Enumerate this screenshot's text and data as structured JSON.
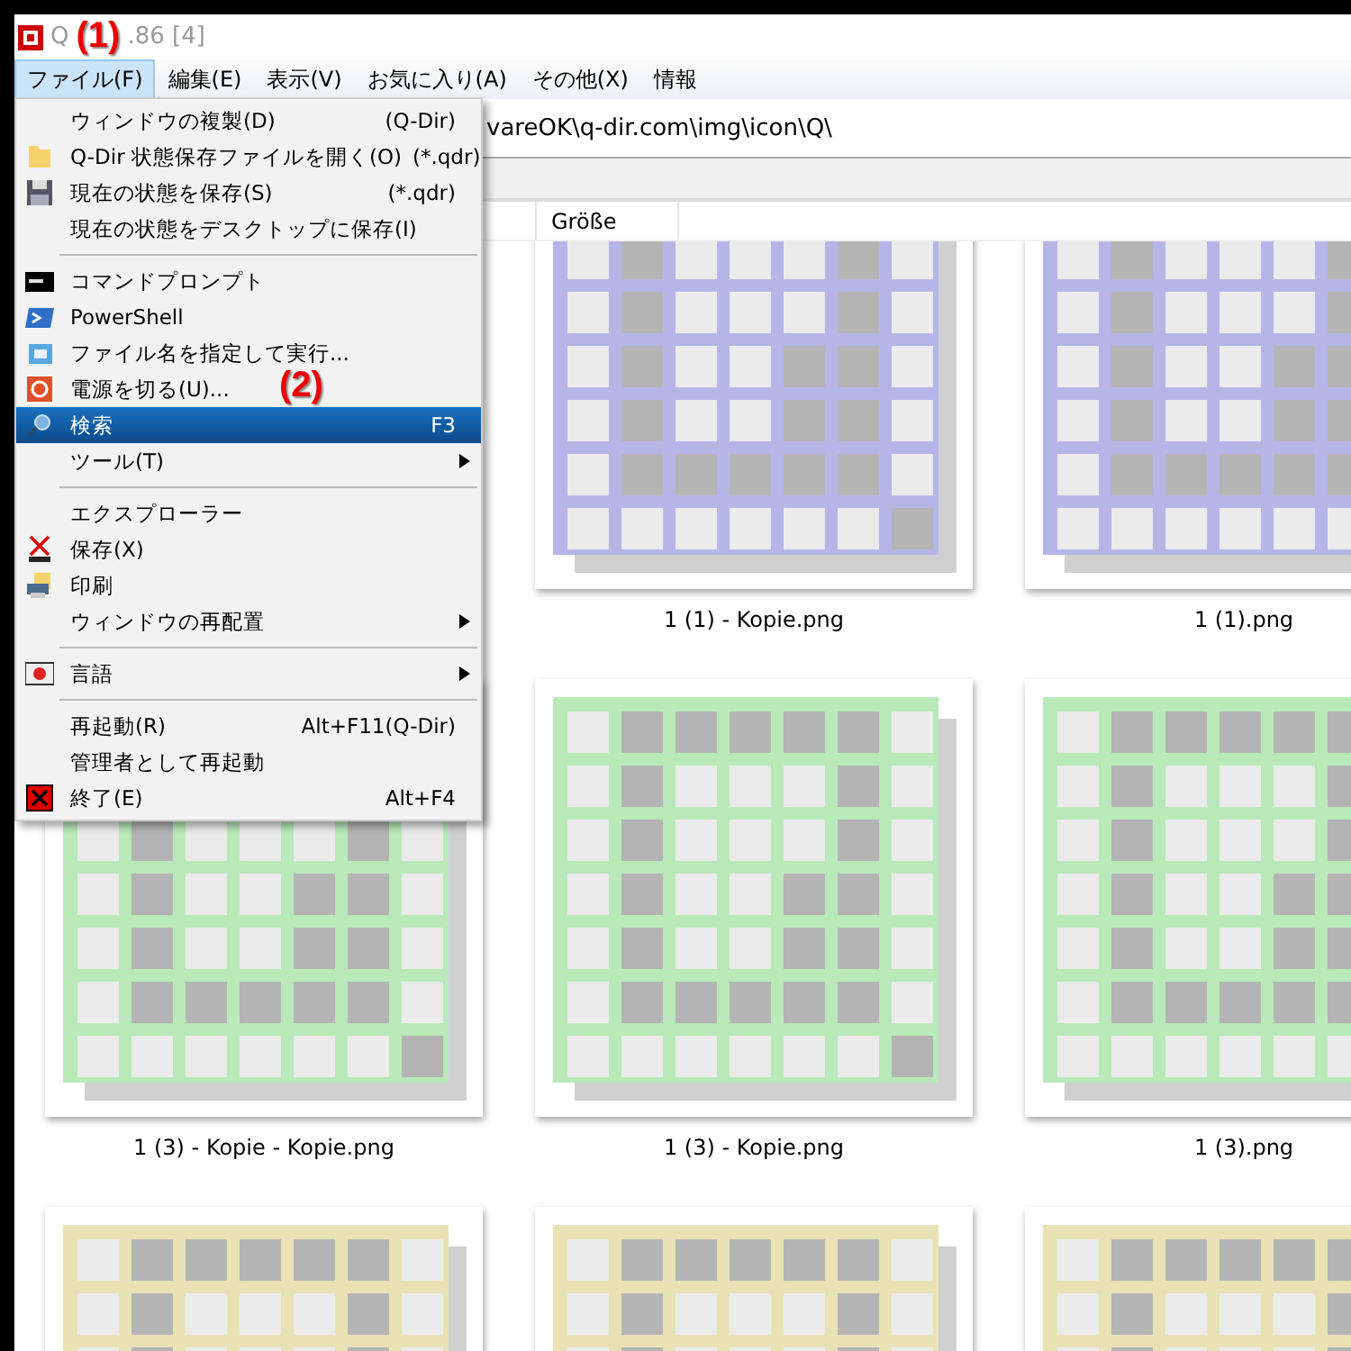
{
  "window": {
    "title_start": "Q",
    "title_end": ".86 [4]"
  },
  "annotations": [
    {
      "label": "(1)"
    },
    {
      "label": "(2)"
    }
  ],
  "menu_bar": [
    {
      "label": "ファイル(F)",
      "selected": true
    },
    {
      "label": "編集(E)",
      "selected": false
    },
    {
      "label": "表示(V)",
      "selected": false
    },
    {
      "label": "お気に入り(A)",
      "selected": false
    },
    {
      "label": "その他(X)",
      "selected": false
    },
    {
      "label": "情報",
      "selected": false
    }
  ],
  "address": {
    "value": "vareOK\\q-dir.com\\img\\icon\\Q\\"
  },
  "columns": [
    {
      "label": "Größe"
    }
  ],
  "menu": [
    {
      "kind": "item",
      "label": "ウィンドウの複製(D)",
      "shortcut": "(Q-Dir)",
      "selected": false
    },
    {
      "kind": "folder",
      "label": "Q-Dir 状態保存ファイルを開く(O)",
      "shortcut": "(*.qdr)",
      "selected": false
    },
    {
      "kind": "floppy",
      "label": "現在の状態を保存(S)",
      "shortcut": "(*.qdr)",
      "selected": false
    },
    {
      "kind": "item",
      "label": "現在の状態をデスクトップに保存(I)",
      "selected": false
    },
    {
      "kind": "separator"
    },
    {
      "kind": "console",
      "label": "コマンドプロンプト",
      "selected": false
    },
    {
      "kind": "shell",
      "label": "PowerShell",
      "selected": false
    },
    {
      "kind": "run",
      "label": "ファイル名を指定して実行...",
      "selected": false
    },
    {
      "kind": "power",
      "label": "電源を切る(U)...",
      "selected": false
    },
    {
      "kind": "search",
      "label": "検索",
      "shortcut": "F3",
      "selected": true
    },
    {
      "kind": "submenu",
      "label": "ツール(T)",
      "selected": false
    },
    {
      "kind": "separator"
    },
    {
      "kind": "item",
      "label": "エクスプローラー",
      "selected": false
    },
    {
      "kind": "cross",
      "label": "保存(X)",
      "selected": false
    },
    {
      "kind": "printer",
      "label": "印刷",
      "selected": false
    },
    {
      "kind": "submenu",
      "label": "ウィンドウの再配置",
      "selected": false
    },
    {
      "kind": "separator"
    },
    {
      "kind": "language",
      "label": "言語",
      "selected": false
    },
    {
      "kind": "separator"
    },
    {
      "kind": "item",
      "label": "再起動(R)",
      "shortcut": "Alt+F11(Q-Dir)",
      "selected": false
    },
    {
      "kind": "item",
      "label": "管理者として再起動",
      "selected": false
    },
    {
      "kind": "exit",
      "label": "終了(E)",
      "shortcut": "Alt+F4",
      "selected": false
    }
  ],
  "thumbnail_rows": [
    {
      "items": [
        {
          "name": "1 (1) - Kopie.png",
          "color": "#b5b5e8"
        },
        {
          "name": "1 (1).png",
          "color": "#b5b5e8"
        }
      ]
    },
    {
      "items": [
        {
          "name": "1 (3) - Kopie - Kopie.png",
          "color": "#b9e8b9"
        },
        {
          "name": "1 (3) - Kopie.png",
          "color": "#b9e8b9"
        },
        {
          "name": "1 (3).png",
          "color": "#b9e8b9"
        }
      ]
    },
    {
      "items": [
        {
          "color": "#e8e2b5"
        },
        {
          "color": "#e8e2b5"
        },
        {
          "color": "#e8e2b5"
        }
      ]
    }
  ]
}
